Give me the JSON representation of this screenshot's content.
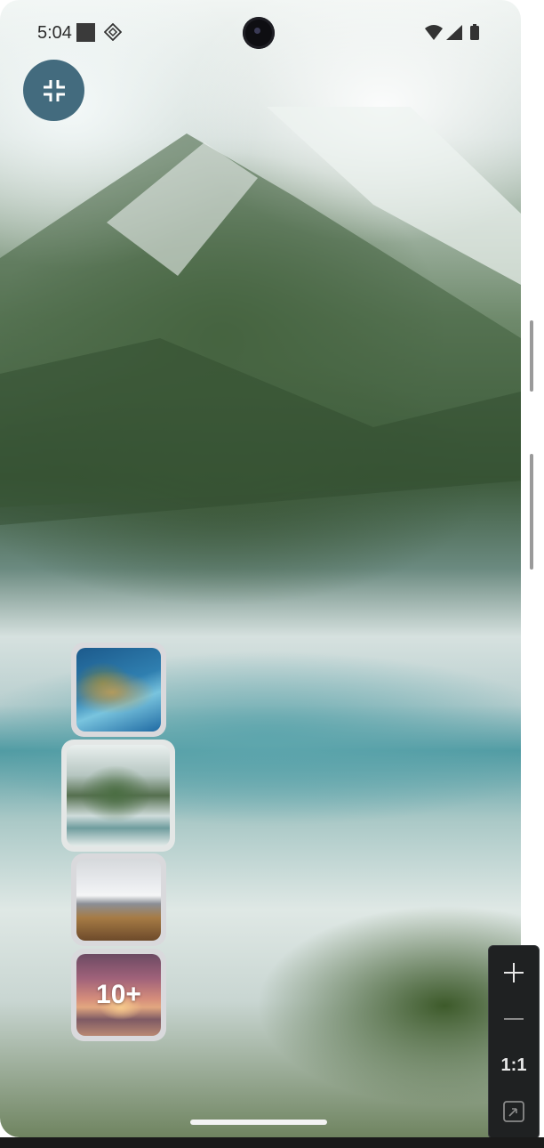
{
  "status_bar": {
    "time": "5:04",
    "icons": [
      "stop-square-icon",
      "gesture-diamond-icon",
      "wifi-icon",
      "cellular-signal-icon",
      "battery-icon"
    ]
  },
  "viewer": {
    "background_image": "mountain-river-aerial",
    "exit_fullscreen_icon": "fullscreen-exit-icon"
  },
  "thumbnails": [
    {
      "image": "coastal-island-aerial",
      "selected": false
    },
    {
      "image": "green-mountain-river",
      "selected": true
    },
    {
      "image": "snowy-mountain-range",
      "selected": false
    },
    {
      "image": "beach-sunset",
      "overlay_label": "10+",
      "selected": false
    }
  ],
  "zoom_controls": {
    "zoom_in_icon": "plus-icon",
    "zoom_out_icon": "minus-icon",
    "reset_label": "1:1",
    "fit_icon": "fit-to-screen-icon"
  },
  "colors": {
    "accent_button": "#436b7e",
    "zoom_panel_bg": "#1f2122"
  }
}
